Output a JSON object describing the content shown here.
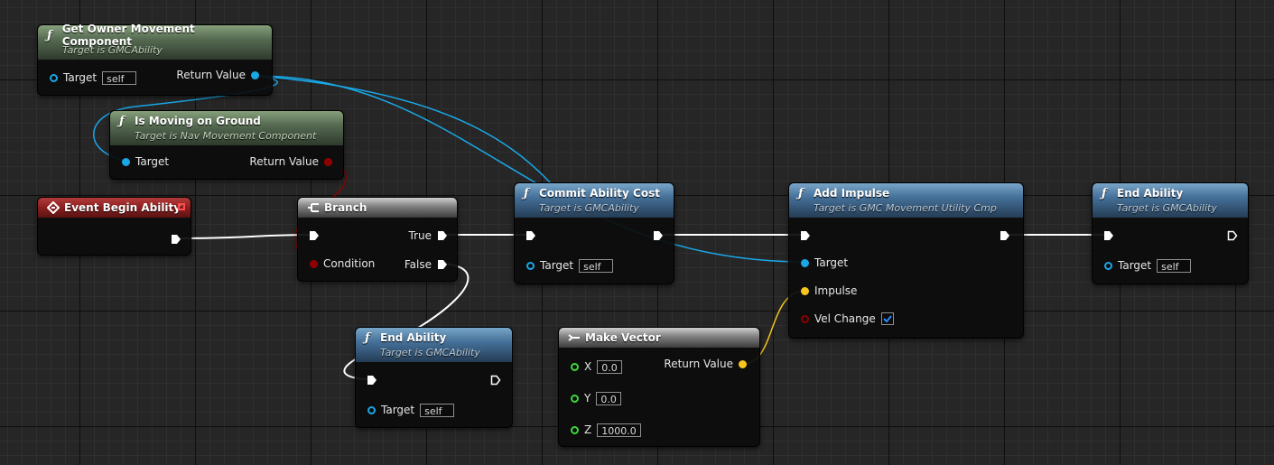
{
  "nodes": {
    "get_owner_movement": {
      "title": "Get Owner Movement Component",
      "subtitle": "Target is GMCAbility",
      "target_label": "Target",
      "target_value": "self",
      "return_label": "Return Value"
    },
    "is_moving": {
      "title": "Is Moving on Ground",
      "subtitle": "Target is Nav Movement Component",
      "target_label": "Target",
      "return_label": "Return Value"
    },
    "event_begin": {
      "title": "Event Begin Ability"
    },
    "branch": {
      "title": "Branch",
      "true_label": "True",
      "false_label": "False",
      "condition_label": "Condition"
    },
    "commit_cost": {
      "title": "Commit Ability Cost",
      "subtitle": "Target is GMCAbility",
      "target_label": "Target",
      "target_value": "self"
    },
    "add_impulse": {
      "title": "Add Impulse",
      "subtitle": "Target is GMC Movement Utility Cmp",
      "target_label": "Target",
      "impulse_label": "Impulse",
      "vel_change_label": "Vel Change",
      "vel_change_checked": true
    },
    "end_ability_right": {
      "title": "End Ability",
      "subtitle": "Target is GMCAbility",
      "target_label": "Target",
      "target_value": "self"
    },
    "end_ability_bottom": {
      "title": "End Ability",
      "subtitle": "Target is GMCAbility",
      "target_label": "Target",
      "target_value": "self"
    },
    "make_vector": {
      "title": "Make Vector",
      "x_label": "X",
      "x_value": "0.0",
      "y_label": "Y",
      "y_value": "0.0",
      "z_label": "Z",
      "z_value": "1000.0",
      "return_label": "Return Value"
    }
  },
  "colors": {
    "exec_wire": "#ffffff",
    "object_wire": "#1aa7e6",
    "bool_wire": "#8d0000",
    "vector_wire": "#f7c51e",
    "float_pin": "#3cd83c"
  }
}
